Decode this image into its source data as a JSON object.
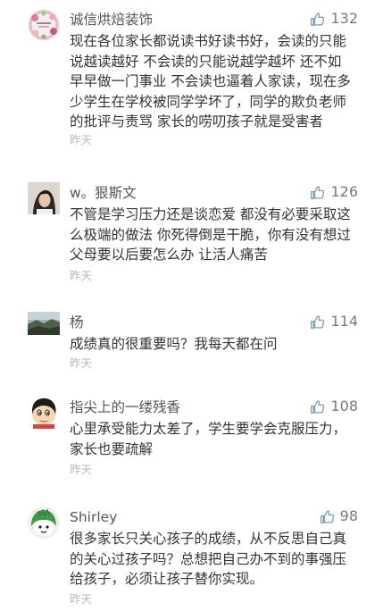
{
  "colors": {
    "text": "#333333",
    "username": "#555555",
    "like_icon": "#7a9bb0",
    "time": "#b8b8b8"
  },
  "comments": [
    {
      "username": "诚信烘焙装饰",
      "likes": "132",
      "avatar_icon": "floral-avatar-icon",
      "text": "现在各位家长都说读书好读书好，会读的只能\n说越读越好 不会读的只能说越学越坏 还不如\n早早做一门事业 不会读也逼着人家读，现在多\n少学生在学校被同学学坏了，同学的欺负老师\n的批评与责骂 家长的唠叨孩子就是受害者",
      "time": "昨天"
    },
    {
      "username": "w。狠斯文",
      "likes": "126",
      "avatar_icon": "portrait-avatar-icon",
      "text": "不管是学习压力还是谈恋爱 都没有必要采取这\n么极端的做法 你死得倒是干脆，你有没有想过\n父母要以后要怎么办 让活人痛苦",
      "time": "昨天"
    },
    {
      "username": "杨",
      "likes": "114",
      "avatar_icon": "landscape-avatar-icon",
      "text": "成绩真的很重要吗？我每天都在问",
      "time": "昨天"
    },
    {
      "username": "指尖上的一缕残香",
      "likes": "108",
      "avatar_icon": "cartoon-boy-avatar-icon",
      "text": "心里承受能力太差了，学生要学会克服压力，\n家长也要疏解",
      "time": "昨天"
    },
    {
      "username": "Shirley",
      "likes": "98",
      "avatar_icon": "green-creature-avatar-icon",
      "text": "很多家长只关心孩子的成绩，从不反思自己真\n的关心过孩子吗？总想把自己办不到的事强压\n给孩子，必须让孩子替你实现。",
      "time": "昨天"
    }
  ]
}
